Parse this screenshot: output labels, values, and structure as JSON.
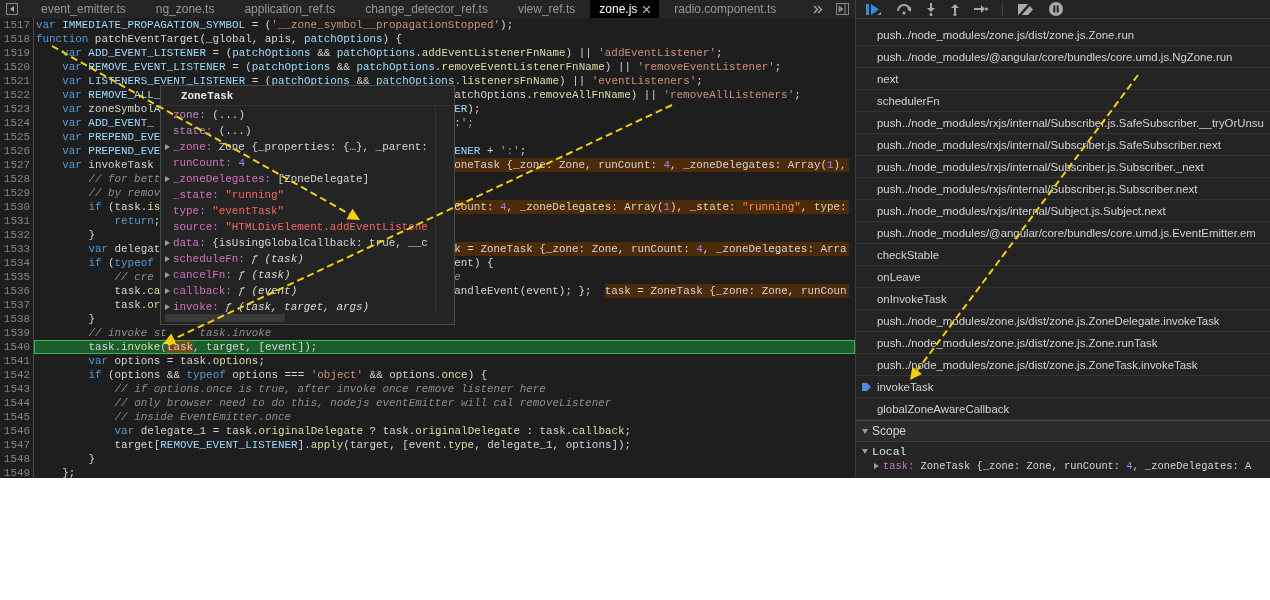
{
  "tabs": [
    {
      "label": "event_emitter.ts",
      "selected": false
    },
    {
      "label": "ng_zone.ts",
      "selected": false
    },
    {
      "label": "application_ref.ts",
      "selected": false
    },
    {
      "label": "change_detector_ref.ts",
      "selected": false
    },
    {
      "label": "view_ref.ts",
      "selected": false
    },
    {
      "label": "zone.js",
      "selected": true
    },
    {
      "label": "radio.component.ts",
      "selected": false
    }
  ],
  "lines": [
    {
      "number": "1517",
      "current": false,
      "text": "var IMMEDIATE_PROPAGATION_SYMBOL = ('__zone_symbol__propagationStopped');"
    },
    {
      "number": "1518",
      "current": false,
      "text": "function patchEventTarget(_global, apis, patchOptions) {"
    },
    {
      "number": "1519",
      "current": false,
      "text": "    var ADD_EVENT_LISTENER = (patchOptions && patchOptions.addEventListenerFnName) || 'addEventListener';"
    },
    {
      "number": "1520",
      "current": false,
      "text": "    var REMOVE_EVENT_LISTENER = (patchOptions && patchOptions.removeEventListenerFnName) || 'removeEventListener';"
    },
    {
      "number": "1521",
      "current": false,
      "text": "    var LISTENERS_EVENT_LISTENER = (patchOptions && patchOptions.listenersFnName) || 'eventListeners';"
    },
    {
      "number": "1522",
      "current": false,
      "text": "    var REMOVE_ALL_",
      "right": [
        {
          "kind": "code",
          "text": "atchOptions.removeAllFnName) || 'removeAllListeners';"
        }
      ]
    },
    {
      "number": "1523",
      "current": false,
      "text": "    var zoneSymbolA",
      "right": [
        {
          "kind": "code",
          "text": "ER);"
        }
      ]
    },
    {
      "number": "1524",
      "current": false,
      "text": "    var ADD_EVENT_",
      "right": [
        {
          "kind": "code",
          "text": ":';"
        }
      ]
    },
    {
      "number": "1525",
      "current": false,
      "text": "    var PREPEND_EVE"
    },
    {
      "number": "1526",
      "current": false,
      "text": "    var PREPEND_EVE",
      "right": [
        {
          "kind": "code",
          "text": "ENER + ':';"
        }
      ]
    },
    {
      "number": "1527",
      "current": false,
      "text": "    var invokeTask",
      "right": [
        {
          "kind": "value",
          "text": "oneTask {_zone: Zone, runCount: 4, _zoneDelegates: Array(1),"
        }
      ]
    },
    {
      "number": "1528",
      "current": false,
      "text": "        // for bett"
    },
    {
      "number": "1529",
      "current": false,
      "text": "        // by remov"
    },
    {
      "number": "1530",
      "current": false,
      "text": "        if (task.is",
      "right": [
        {
          "kind": "value",
          "text": "Count: 4, _zoneDelegates: Array(1), _state: \"running\", type:"
        }
      ]
    },
    {
      "number": "1531",
      "current": false,
      "text": "            return;"
    },
    {
      "number": "1532",
      "current": false,
      "text": "        }"
    },
    {
      "number": "1533",
      "current": false,
      "text": "        var delegat",
      "right": [
        {
          "kind": "value",
          "text": "k = ZoneTask {_zone: Zone, runCount: 4, _zoneDelegates: Arra"
        }
      ]
    },
    {
      "number": "1534",
      "current": false,
      "text": "        if (typeof",
      "right": [
        {
          "kind": "code",
          "text": "ent) {"
        }
      ]
    },
    {
      "number": "1535",
      "current": false,
      "text": "            // cre",
      "right": [
        {
          "kind": "comment",
          "text": "e"
        }
      ]
    },
    {
      "number": "1536",
      "current": false,
      "text": "            task.ca",
      "right": [
        {
          "kind": "code",
          "text": "andleEvent(event); };"
        },
        {
          "kind": "value",
          "text": "task = ZoneTask {_zone: Zone, runCoun"
        }
      ]
    },
    {
      "number": "1537",
      "current": false,
      "text": "            task.or"
    },
    {
      "number": "1538",
      "current": false,
      "text": "        }"
    },
    {
      "number": "1539",
      "current": false,
      "text": "        // invoke st",
      "after_gap": "task.invoke"
    },
    {
      "number": "1540",
      "current": true,
      "parts": [
        {
          "text": "        task.invoke(",
          "hovered": false
        },
        {
          "text": "task",
          "hovered": true
        },
        {
          "text": ", target, [event]);",
          "hovered": false
        }
      ]
    },
    {
      "number": "1541",
      "current": false,
      "text": "        var options = task.options;"
    },
    {
      "number": "1542",
      "current": false,
      "text": "        if (options && typeof options === 'object' && options.once) {"
    },
    {
      "number": "1543",
      "current": false,
      "text": "            // if options.once is true, after invoke once remove listener here"
    },
    {
      "number": "1544",
      "current": false,
      "text": "            // only browser need to do this, nodejs eventEmitter will cal removeListener"
    },
    {
      "number": "1545",
      "current": false,
      "text": "            // inside EventEmitter.once"
    },
    {
      "number": "1546",
      "current": false,
      "text": "            var delegate_1 = task.originalDelegate ? task.originalDelegate : task.callback;"
    },
    {
      "number": "1547",
      "current": false,
      "text": "            target[REMOVE_EVENT_LISTENER].apply(target, [event.type, delegate_1, options]);"
    },
    {
      "number": "1548",
      "current": false,
      "text": "        }"
    },
    {
      "number": "1549",
      "current": false,
      "text": "    };"
    }
  ],
  "popup": {
    "title": "ZoneTask",
    "properties": [
      {
        "key": "zone:",
        "value": "(...)",
        "kind": "getter",
        "expandable": false
      },
      {
        "key": "state:",
        "value": "(...)",
        "kind": "getter",
        "expandable": false
      },
      {
        "key": "_zone:",
        "value": "Zone {_properties: {…}, _parent:",
        "kind": "object",
        "expandable": true
      },
      {
        "key": "runCount:",
        "value": "4",
        "kind": "number",
        "expandable": false
      },
      {
        "key": "_zoneDelegates:",
        "value": "[ZoneDelegate]",
        "kind": "object",
        "expandable": true
      },
      {
        "key": "_state:",
        "value": "\"running\"",
        "kind": "string",
        "expandable": false
      },
      {
        "key": "type:",
        "value": "\"eventTask\"",
        "kind": "string",
        "expandable": false
      },
      {
        "key": "source:",
        "value": "\"HTMLDivElement.addEventListene",
        "kind": "string",
        "expandable": false
      },
      {
        "key": "data:",
        "value": "{isUsingGlobalCallback: true, __c",
        "kind": "object",
        "expandable": true
      },
      {
        "key": "scheduleFn:",
        "value": "ƒ (task)",
        "kind": "function",
        "expandable": true
      },
      {
        "key": "cancelFn:",
        "value": "ƒ (task)",
        "kind": "function",
        "expandable": true
      },
      {
        "key": "callback:",
        "value": "ƒ (event)",
        "kind": "function",
        "expandable": true
      },
      {
        "key": "invoke:",
        "value": "ƒ (task, target, args)",
        "kind": "function",
        "expandable": true
      }
    ]
  },
  "call_stack": [
    {
      "label": "push../node_modules/zone.js/dist/zone.js.Zone.run",
      "current": false
    },
    {
      "label": "push../node_modules/@angular/core/bundles/core.umd.js.NgZone.run",
      "current": false
    },
    {
      "label": "next",
      "current": false
    },
    {
      "label": "schedulerFn",
      "current": false
    },
    {
      "label": "push../node_modules/rxjs/internal/Subscriber.js.SafeSubscriber.__tryOrUnsu",
      "current": false
    },
    {
      "label": "push../node_modules/rxjs/internal/Subscriber.js.SafeSubscriber.next",
      "current": false
    },
    {
      "label": "push../node_modules/rxjs/internal/Subscriber.js.Subscriber._next",
      "current": false
    },
    {
      "label": "push../node_modules/rxjs/internal/Subscriber.js.Subscriber.next",
      "current": false
    },
    {
      "label": "push../node_modules/rxjs/internal/Subject.js.Subject.next",
      "current": false
    },
    {
      "label": "push../node_modules/@angular/core/bundles/core.umd.js.EventEmitter.em",
      "current": false
    },
    {
      "label": "checkStable",
      "current": false
    },
    {
      "label": "onLeave",
      "current": false
    },
    {
      "label": "onInvokeTask",
      "current": false
    },
    {
      "label": "push../node_modules/zone.js/dist/zone.js.ZoneDelegate.invokeTask",
      "current": false
    },
    {
      "label": "push../node_modules/zone.js/dist/zone.js.Zone.runTask",
      "current": false
    },
    {
      "label": "push../node_modules/zone.js/dist/zone.js.ZoneTask.invokeTask",
      "current": false
    },
    {
      "label": "invokeTask",
      "current": true
    },
    {
      "label": "globalZoneAwareCallback",
      "current": false
    }
  ],
  "scope": {
    "title": "Scope",
    "expanded": true,
    "local": {
      "title": "Local",
      "expanded": true,
      "variables": [
        {
          "key": "task:",
          "value": "ZoneTask {_zone: Zone, runCount: 4, _zoneDelegates: A"
        }
      ]
    }
  }
}
